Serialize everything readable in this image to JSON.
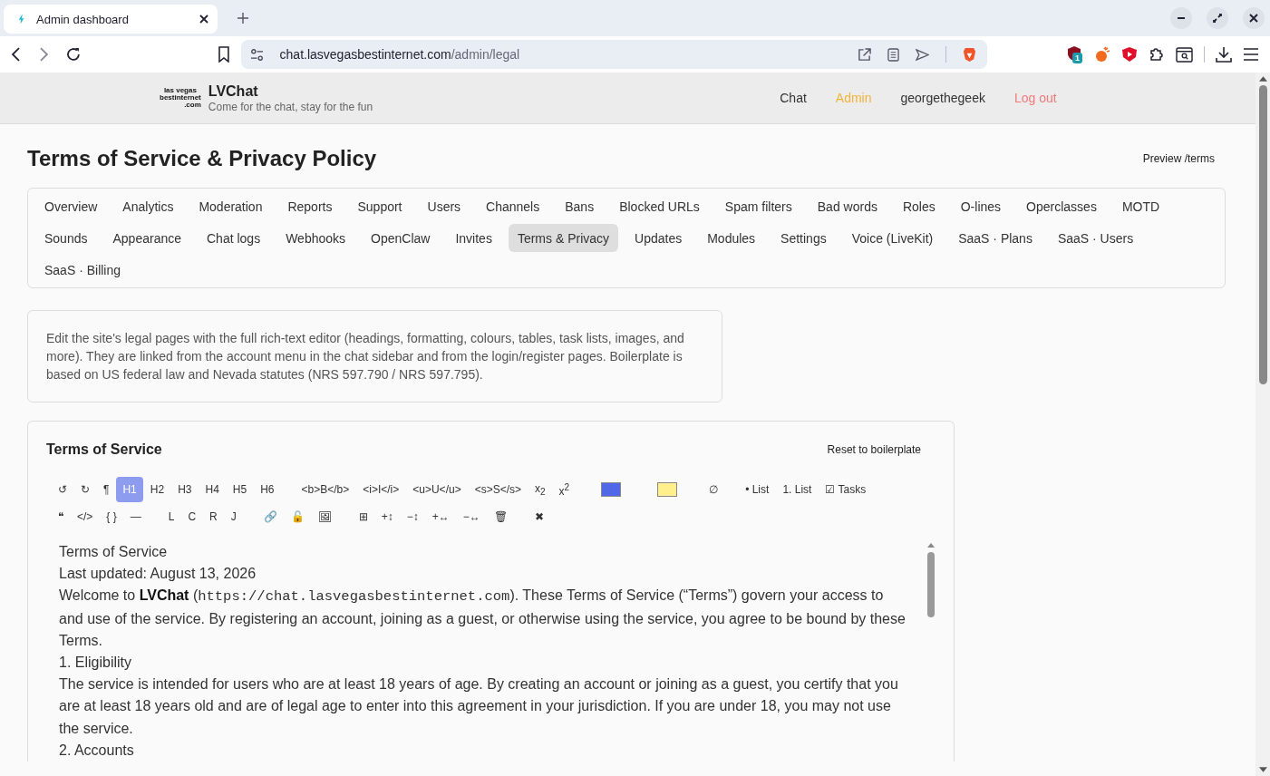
{
  "browser": {
    "tab": {
      "title": "Admin dashboard",
      "selected": true
    },
    "url_host": "chat.lasvegasbestinternet.com",
    "url_path": "/admin/legal",
    "extension_badge": "1"
  },
  "header": {
    "logo_text": [
      "las vegas",
      "bestinternet",
      ".com"
    ],
    "brand": "LVChat",
    "tagline": "Come for the chat, stay for the fun",
    "nav": [
      {
        "label": "Chat",
        "kind": "plain"
      },
      {
        "label": "Admin",
        "kind": "active"
      },
      {
        "label": "georgethegeek",
        "kind": "plain"
      },
      {
        "label": "Log out",
        "kind": "danger"
      }
    ]
  },
  "page": {
    "title": "Terms of Service & Privacy Policy",
    "preview_link": "Preview /terms"
  },
  "admin_tabs": [
    {
      "label": "Overview",
      "selected": false
    },
    {
      "label": "Analytics",
      "selected": false
    },
    {
      "label": "Moderation",
      "selected": false
    },
    {
      "label": "Reports",
      "selected": false
    },
    {
      "label": "Support",
      "selected": false
    },
    {
      "label": "Users",
      "selected": false
    },
    {
      "label": "Channels",
      "selected": false
    },
    {
      "label": "Bans",
      "selected": false
    },
    {
      "label": "Blocked URLs",
      "selected": false
    },
    {
      "label": "Spam filters",
      "selected": false
    },
    {
      "label": "Bad words",
      "selected": false
    },
    {
      "label": "Roles",
      "selected": false
    },
    {
      "label": "O-lines",
      "selected": false
    },
    {
      "label": "Operclasses",
      "selected": false
    },
    {
      "label": "MOTD",
      "selected": false
    },
    {
      "label": "Sounds",
      "selected": false
    },
    {
      "label": "Appearance",
      "selected": false
    },
    {
      "label": "Chat logs",
      "selected": false
    },
    {
      "label": "Webhooks",
      "selected": false
    },
    {
      "label": "OpenClaw",
      "selected": false
    },
    {
      "label": "Invites",
      "selected": false
    },
    {
      "label": "Terms & Privacy",
      "selected": true
    },
    {
      "label": "Updates",
      "selected": false
    },
    {
      "label": "Modules",
      "selected": false
    },
    {
      "label": "Settings",
      "selected": false
    },
    {
      "label": "Voice (LiveKit)",
      "selected": false
    },
    {
      "label": "SaaS · Plans",
      "selected": false
    },
    {
      "label": "SaaS · Users",
      "selected": false
    },
    {
      "label": "SaaS · Billing",
      "selected": false
    }
  ],
  "info": "Edit the site's legal pages with the full rich-text editor (headings, formatting, colours, tables, task lists, images, and more). They are linked from the account menu in the chat sidebar and from the login/register pages. Boilerplate is based on US federal law and Nevada statutes (NRS 597.790 / NRS 597.795).",
  "editor": {
    "title": "Terms of Service",
    "reset": "Reset to boilerplate",
    "toolbar": [
      [
        [
          {
            "kind": "tool",
            "label": "↺",
            "selected": false
          },
          {
            "kind": "tool",
            "label": "↻",
            "selected": false
          },
          {
            "kind": "tool",
            "label": "¶",
            "selected": false
          },
          {
            "kind": "tool",
            "label": "H1",
            "selected": true
          },
          {
            "kind": "tool",
            "label": "H2",
            "selected": false
          },
          {
            "kind": "tool",
            "label": "H3",
            "selected": false
          },
          {
            "kind": "tool",
            "label": "H4",
            "selected": false
          },
          {
            "kind": "tool",
            "label": "H5",
            "selected": false
          },
          {
            "kind": "tool",
            "label": "H6",
            "selected": false
          }
        ],
        [
          {
            "kind": "tool",
            "label": "<b>B</b>",
            "selected": false
          },
          {
            "kind": "tool",
            "label": "<i>I</i>",
            "selected": false
          },
          {
            "kind": "tool",
            "label": "<u>U</u>",
            "selected": false
          },
          {
            "kind": "tool",
            "label": "<s>S</s>",
            "selected": false
          },
          {
            "kind": "tool",
            "label": "x$_{2}$",
            "selected": false
          },
          {
            "kind": "tool",
            "label": "x$^{2}$",
            "selected": false
          }
        ],
        [
          {
            "kind": "swatch",
            "color": "#5068e8"
          }
        ],
        [
          {
            "kind": "swatch",
            "color": "#fff08c"
          }
        ],
        [
          {
            "kind": "tool",
            "label": "∅",
            "selected": false
          }
        ],
        [
          {
            "kind": "tool",
            "label": "• List",
            "selected": false
          },
          {
            "kind": "tool",
            "label": "1. List",
            "selected": false
          },
          {
            "kind": "tool",
            "label": "☑ Tasks",
            "selected": false
          }
        ]
      ],
      [
        [
          {
            "kind": "tool",
            "label": "❝",
            "selected": false
          },
          {
            "kind": "tool",
            "label": "</>",
            "selected": false
          },
          {
            "kind": "tool",
            "label": "{ }",
            "selected": false
          },
          {
            "kind": "tool",
            "label": "—",
            "selected": false
          }
        ],
        [
          {
            "kind": "tool",
            "label": "L",
            "selected": false
          },
          {
            "kind": "tool",
            "label": "C",
            "selected": false
          },
          {
            "kind": "tool",
            "label": "R",
            "selected": false
          },
          {
            "kind": "tool",
            "label": "J",
            "selected": false
          }
        ],
        [
          {
            "kind": "tool",
            "label": "🔗",
            "selected": false
          },
          {
            "kind": "tool",
            "label": "🔓",
            "selected": false
          },
          {
            "kind": "tool",
            "label": "🖼",
            "selected": false
          }
        ],
        [
          {
            "kind": "tool",
            "label": "⊞",
            "selected": false
          },
          {
            "kind": "tool",
            "label": "+↕",
            "selected": false
          },
          {
            "kind": "tool",
            "label": "−↕",
            "selected": false
          },
          {
            "kind": "tool",
            "label": "+↔",
            "selected": false
          },
          {
            "kind": "tool",
            "label": "−↔",
            "selected": false
          },
          {
            "kind": "tool",
            "label": "🗑",
            "selected": false
          }
        ],
        [
          {
            "kind": "tool",
            "label": "✖",
            "selected": false
          }
        ]
      ]
    ],
    "content": [
      [
        {
          "text": "Terms of Service"
        }
      ],
      [
        {
          "text": "Last updated: August 13, 2026"
        }
      ],
      [
        {
          "text": "Welcome to "
        },
        {
          "text": "LVChat",
          "kind": "bold"
        },
        {
          "text": " ("
        },
        {
          "text": "https://chat.lasvegasbestinternet.com",
          "kind": "code"
        },
        {
          "text": "). These Terms of Service (“Terms”) govern your access to and use of the service. By registering an account, joining as a guest, or otherwise using the service, you agree to be bound by these Terms."
        }
      ],
      [
        {
          "text": "1. Eligibility"
        }
      ],
      [
        {
          "text": "The service is intended for users who are at least 18 years of age. By creating an account or joining as a guest, you certify that you are at least 18 years old and are of legal age to enter into this agreement in your jurisdiction. If you are under 18, you may not use the service."
        }
      ],
      [
        {
          "text": "2. Accounts"
        }
      ]
    ]
  }
}
